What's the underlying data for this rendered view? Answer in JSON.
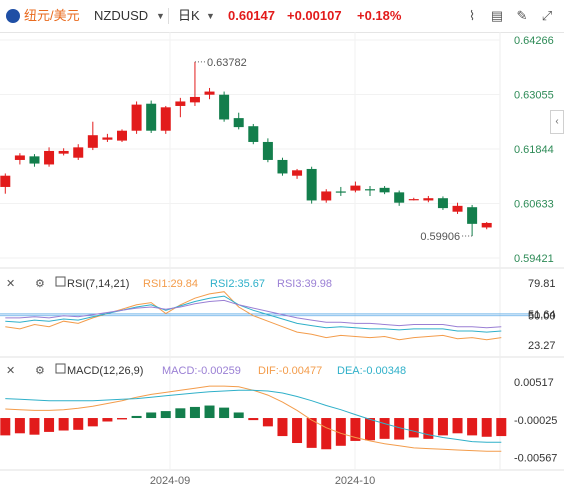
{
  "header": {
    "pair_cn": "纽元/美元",
    "symbol": "NZDUSD",
    "period": "日K",
    "price": "0.60147",
    "change": "+0.00107",
    "change_pct": "+0.18%",
    "tools": [
      "chart-type-icon",
      "crosshair-icon",
      "draw-icon",
      "fullscreen-icon",
      "close-icon"
    ],
    "up_color": "#e21b1b",
    "down_color": "#137e4c"
  },
  "chart_data": [
    {
      "type": "candlestick",
      "y_ticks": [
        "0.64266",
        "0.63055",
        "0.61844",
        "0.60633",
        "0.59421"
      ],
      "ylim": [
        0.59421,
        0.64266
      ],
      "x_ticks": [
        "2024-09",
        "2024-10"
      ],
      "annotations": [
        {
          "label": "0.63782",
          "kind": "high"
        },
        {
          "label": "0.59906",
          "kind": "low"
        }
      ],
      "last_price": 0.60147,
      "candles": [
        {
          "o": 0.61,
          "c": 0.6125,
          "h": 0.613,
          "l": 0.6085
        },
        {
          "o": 0.616,
          "c": 0.617,
          "h": 0.6175,
          "l": 0.615
        },
        {
          "o": 0.6168,
          "c": 0.6152,
          "h": 0.6173,
          "l": 0.6145
        },
        {
          "o": 0.615,
          "c": 0.618,
          "h": 0.6188,
          "l": 0.6145
        },
        {
          "o": 0.6174,
          "c": 0.618,
          "h": 0.6186,
          "l": 0.617
        },
        {
          "o": 0.6165,
          "c": 0.6188,
          "h": 0.6195,
          "l": 0.616
        },
        {
          "o": 0.6187,
          "c": 0.6215,
          "h": 0.6245,
          "l": 0.6182
        },
        {
          "o": 0.6205,
          "c": 0.621,
          "h": 0.6218,
          "l": 0.62
        },
        {
          "o": 0.6203,
          "c": 0.6225,
          "h": 0.6228,
          "l": 0.62
        },
        {
          "o": 0.6225,
          "c": 0.6283,
          "h": 0.629,
          "l": 0.6218
        },
        {
          "o": 0.6285,
          "c": 0.6225,
          "h": 0.6292,
          "l": 0.622
        },
        {
          "o": 0.6225,
          "c": 0.6277,
          "h": 0.628,
          "l": 0.6218
        },
        {
          "o": 0.628,
          "c": 0.629,
          "h": 0.6298,
          "l": 0.6255
        },
        {
          "o": 0.6288,
          "c": 0.63,
          "h": 0.6378,
          "l": 0.628
        },
        {
          "o": 0.6305,
          "c": 0.6312,
          "h": 0.632,
          "l": 0.6295
        },
        {
          "o": 0.6305,
          "c": 0.625,
          "h": 0.6312,
          "l": 0.6245
        },
        {
          "o": 0.6253,
          "c": 0.6233,
          "h": 0.6265,
          "l": 0.6228
        },
        {
          "o": 0.6235,
          "c": 0.62,
          "h": 0.624,
          "l": 0.6195
        },
        {
          "o": 0.62,
          "c": 0.616,
          "h": 0.6208,
          "l": 0.6155
        },
        {
          "o": 0.616,
          "c": 0.613,
          "h": 0.6165,
          "l": 0.6125
        },
        {
          "o": 0.6125,
          "c": 0.6137,
          "h": 0.614,
          "l": 0.6118
        },
        {
          "o": 0.614,
          "c": 0.607,
          "h": 0.6145,
          "l": 0.6063
        },
        {
          "o": 0.607,
          "c": 0.609,
          "h": 0.6095,
          "l": 0.6065
        },
        {
          "o": 0.609,
          "c": 0.6089,
          "h": 0.61,
          "l": 0.608
        },
        {
          "o": 0.6092,
          "c": 0.6103,
          "h": 0.6112,
          "l": 0.6088
        },
        {
          "o": 0.6095,
          "c": 0.6093,
          "h": 0.6102,
          "l": 0.608
        },
        {
          "o": 0.6098,
          "c": 0.6088,
          "h": 0.6102,
          "l": 0.6084
        },
        {
          "o": 0.6088,
          "c": 0.6065,
          "h": 0.6092,
          "l": 0.6058
        },
        {
          "o": 0.6072,
          "c": 0.6073,
          "h": 0.6076,
          "l": 0.607
        },
        {
          "o": 0.607,
          "c": 0.6075,
          "h": 0.608,
          "l": 0.6066
        },
        {
          "o": 0.6075,
          "c": 0.6053,
          "h": 0.6079,
          "l": 0.6049
        },
        {
          "o": 0.6045,
          "c": 0.6058,
          "h": 0.6065,
          "l": 0.604
        },
        {
          "o": 0.6055,
          "c": 0.6018,
          "h": 0.606,
          "l": 0.5991
        },
        {
          "o": 0.601,
          "c": 0.602,
          "h": 0.6022,
          "l": 0.6006
        }
      ]
    },
    {
      "type": "line",
      "name": "RSI(7,14,21)",
      "indicator_values": {
        "RSI1": "29.84",
        "RSI2": "35.67",
        "RSI3": "39.98"
      },
      "y_ticks": [
        "79.81",
        "51.64",
        "50.00",
        "23.27"
      ],
      "ylim": [
        15,
        90
      ],
      "colors": {
        "RSI1": "#f39c4b",
        "RSI2": "#2fb0c9",
        "RSI3": "#9a7fd4"
      },
      "reference_lines": [
        50,
        51.64
      ],
      "series": [
        {
          "name": "RSI1",
          "values": [
            40,
            38,
            42,
            40,
            45,
            43,
            48,
            52,
            56,
            60,
            62,
            52,
            60,
            66,
            70,
            72,
            58,
            50,
            45,
            40,
            35,
            33,
            30,
            32,
            31,
            30,
            31,
            28,
            30,
            31,
            32,
            29,
            30,
            28,
            30
          ]
        },
        {
          "name": "RSI2",
          "values": [
            45,
            44,
            46,
            45,
            47,
            46,
            49,
            52,
            55,
            58,
            60,
            55,
            59,
            63,
            66,
            68,
            60,
            55,
            51,
            47,
            43,
            41,
            39,
            40,
            39,
            38,
            38,
            37,
            38,
            38,
            38,
            36,
            36,
            35,
            36
          ]
        },
        {
          "name": "RSI3",
          "values": [
            48,
            48,
            49,
            48,
            50,
            49,
            51,
            53,
            55,
            57,
            58,
            56,
            58,
            61,
            63,
            64,
            60,
            57,
            54,
            51,
            48,
            46,
            44,
            44,
            43,
            43,
            42,
            41,
            42,
            42,
            42,
            40,
            40,
            39,
            40
          ]
        }
      ]
    },
    {
      "type": "bar",
      "name": "MACD(12,26,9)",
      "indicator_values": {
        "MACD": "-0.00259",
        "DIF": "-0.00477",
        "DEA": "-0.00348"
      },
      "y_ticks": [
        "0.00517",
        "-0.00025",
        "-0.00567"
      ],
      "ylim": [
        -0.0072,
        0.0062
      ],
      "colors": {
        "MACD": "#9a7fd4",
        "DIF": "#f39c4b",
        "DEA": "#2fb0c9"
      },
      "series": [
        {
          "name": "MACD",
          "values": [
            -0.0025,
            -0.0022,
            -0.0024,
            -0.002,
            -0.0018,
            -0.0017,
            -0.0012,
            -0.0005,
            -0.0002,
            0.0003,
            0.0008,
            0.001,
            0.0014,
            0.0016,
            0.0018,
            0.0015,
            0.0008,
            -0.0003,
            -0.0012,
            -0.0026,
            -0.0036,
            -0.0043,
            -0.0045,
            -0.004,
            -0.0033,
            -0.0032,
            -0.003,
            -0.0031,
            -0.0028,
            -0.003,
            -0.0025,
            -0.0022,
            -0.0025,
            -0.0027,
            -0.0026
          ]
        },
        {
          "name": "DIF",
          "values": [
            0.0013,
            0.0012,
            0.0011,
            0.0011,
            0.0012,
            0.0014,
            0.0017,
            0.0021,
            0.0025,
            0.003,
            0.0034,
            0.0037,
            0.004,
            0.0043,
            0.0046,
            0.0046,
            0.0045,
            0.004,
            0.0033,
            0.0023,
            0.0011,
            -0.0003,
            -0.0014,
            -0.0022,
            -0.0028,
            -0.0033,
            -0.0037,
            -0.004,
            -0.0043,
            -0.0044,
            -0.0045,
            -0.0046,
            -0.0047,
            -0.0048,
            -0.0048
          ]
        },
        {
          "name": "DEA",
          "values": [
            0.0028,
            0.0027,
            0.0026,
            0.0025,
            0.0025,
            0.0025,
            0.0025,
            0.0026,
            0.0027,
            0.0028,
            0.003,
            0.0032,
            0.0034,
            0.0036,
            0.0038,
            0.0039,
            0.004,
            0.004,
            0.0039,
            0.0036,
            0.0031,
            0.0025,
            0.0018,
            0.0012,
            0.0005,
            -0.0002,
            -0.0008,
            -0.0014,
            -0.0019,
            -0.0024,
            -0.0028,
            -0.0031,
            -0.0034,
            -0.0035,
            -0.0035
          ]
        }
      ]
    }
  ]
}
